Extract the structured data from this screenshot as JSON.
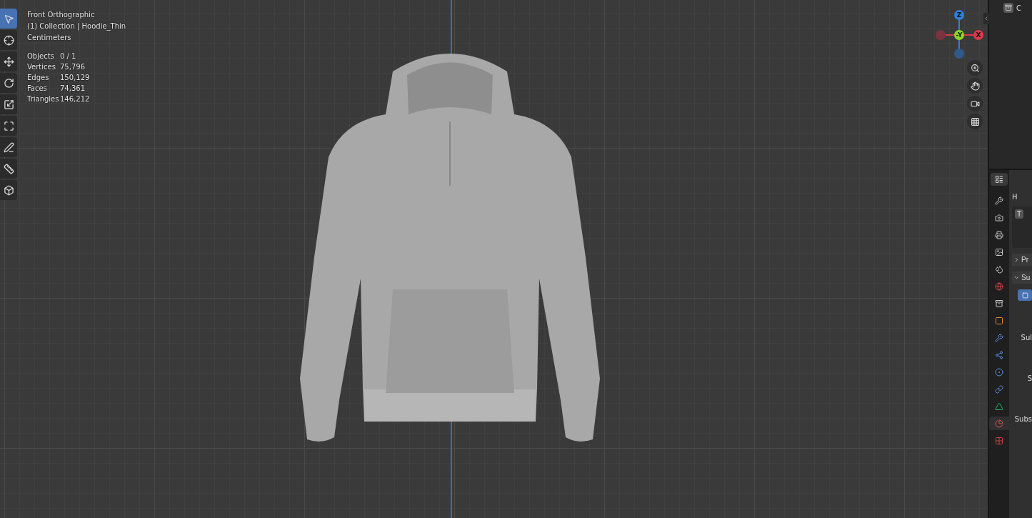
{
  "viewport": {
    "view_name": "Front Orthographic",
    "collection": "(1) Collection | Hoodie_Thin",
    "units": "Centimeters",
    "stats": [
      {
        "label": "Objects",
        "value": "0 / 1"
      },
      {
        "label": "Vertices",
        "value": "75,796"
      },
      {
        "label": "Edges",
        "value": "150,129"
      },
      {
        "label": "Faces",
        "value": "74,361"
      },
      {
        "label": "Triangles",
        "value": "146,212"
      }
    ],
    "tools": [
      {
        "kind": "select",
        "selected": true
      },
      {
        "kind": "cursor",
        "selected": false
      },
      {
        "kind": "move",
        "selected": false
      },
      {
        "kind": "rotate",
        "selected": false
      },
      {
        "kind": "scale",
        "selected": false
      },
      {
        "kind": "transform",
        "selected": false
      },
      {
        "kind": "annotate",
        "selected": false
      },
      {
        "kind": "measure",
        "selected": false
      },
      {
        "kind": "add-cube",
        "selected": false
      }
    ],
    "gizmo": {
      "z": "Z",
      "y": "-Y",
      "x": "X"
    },
    "nav_buttons": [
      {
        "kind": "zoom"
      },
      {
        "kind": "pan"
      },
      {
        "kind": "camera"
      },
      {
        "kind": "ortho"
      }
    ]
  },
  "outliner": {
    "items": [
      {
        "label": "C"
      }
    ]
  },
  "properties": {
    "tabs": [
      {
        "kind": "tool",
        "selected": false
      },
      {
        "kind": "render",
        "selected": false
      },
      {
        "kind": "output",
        "selected": false
      },
      {
        "kind": "view-layer",
        "selected": false
      },
      {
        "kind": "scene",
        "selected": false
      },
      {
        "kind": "world",
        "selected": false
      },
      {
        "kind": "collection",
        "selected": false
      },
      {
        "kind": "object",
        "selected": false
      },
      {
        "kind": "modifiers",
        "selected": false
      },
      {
        "kind": "particles",
        "selected": false
      },
      {
        "kind": "physics",
        "selected": false
      },
      {
        "kind": "constraints",
        "selected": false
      },
      {
        "kind": "data",
        "selected": false
      },
      {
        "kind": "material",
        "selected": true
      },
      {
        "kind": "texture",
        "selected": false
      }
    ],
    "header": "H",
    "slot": "T",
    "sections": [
      {
        "label": "Pr",
        "expanded": false
      },
      {
        "label": "Su",
        "expanded": true
      }
    ],
    "fields": [
      "Sul",
      "S",
      "Subs"
    ]
  }
}
